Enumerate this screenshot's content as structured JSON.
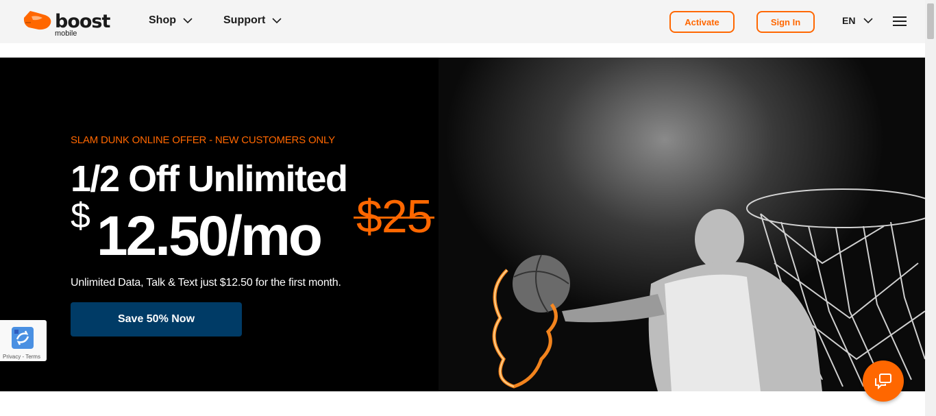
{
  "header": {
    "logo_text": "boost",
    "logo_subtext": "mobile",
    "nav": [
      {
        "label": "Shop"
      },
      {
        "label": "Support"
      }
    ],
    "activate_label": "Activate",
    "sign_in_label": "Sign In",
    "language": "EN"
  },
  "hero": {
    "eyebrow": "SLAM DUNK ONLINE OFFER - NEW CUSTOMERS ONLY",
    "headline": "1/2 Off Unlimited",
    "price_symbol": "$",
    "price_amount": "12.50/mo",
    "old_price": "$25",
    "subtext": "Unlimited Data, Talk & Text just $12.50 for the first month.",
    "cta_label": "Save 50% Now"
  },
  "recaptcha": {
    "links": "Privacy - Terms"
  },
  "colors": {
    "accent": "#ff6700",
    "cta_bg": "#003b66",
    "hero_bg": "#000000"
  },
  "icons": [
    "boost-logo-icon",
    "chevron-down-icon",
    "hamburger-menu-icon",
    "recaptcha-icon",
    "chat-icon"
  ]
}
